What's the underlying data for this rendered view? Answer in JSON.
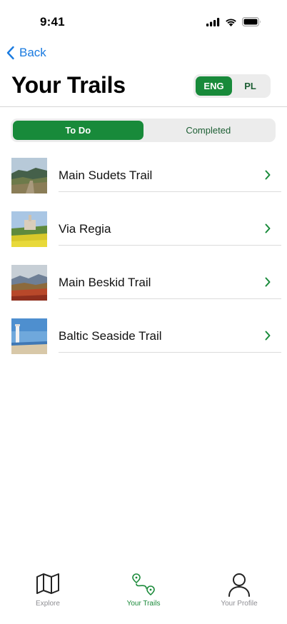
{
  "status": {
    "time": "9:41"
  },
  "nav": {
    "back_label": "Back"
  },
  "header": {
    "title": "Your Trails"
  },
  "language": {
    "options": [
      "ENG",
      "PL"
    ],
    "selected": "ENG"
  },
  "segments": {
    "options": [
      "To Do",
      "Completed"
    ],
    "selected": "To Do"
  },
  "trails": [
    {
      "name": "Main Sudets Trail",
      "thumb": "mountain-landscape"
    },
    {
      "name": "Via Regia",
      "thumb": "castle-field"
    },
    {
      "name": "Main Beskid Trail",
      "thumb": "autumn-mountains"
    },
    {
      "name": "Baltic Seaside Trail",
      "thumb": "lighthouse-beach"
    }
  ],
  "tabbar": {
    "items": [
      {
        "label": "Explore",
        "icon": "map-icon",
        "active": false
      },
      {
        "label": "Your Trails",
        "icon": "route-icon",
        "active": true
      },
      {
        "label": "Your Profile",
        "icon": "person-icon",
        "active": false
      }
    ]
  },
  "colors": {
    "accent": "#188a3a",
    "link": "#1a7be0",
    "control_bg": "#ececec",
    "inactive_tab": "#8e8e93"
  }
}
